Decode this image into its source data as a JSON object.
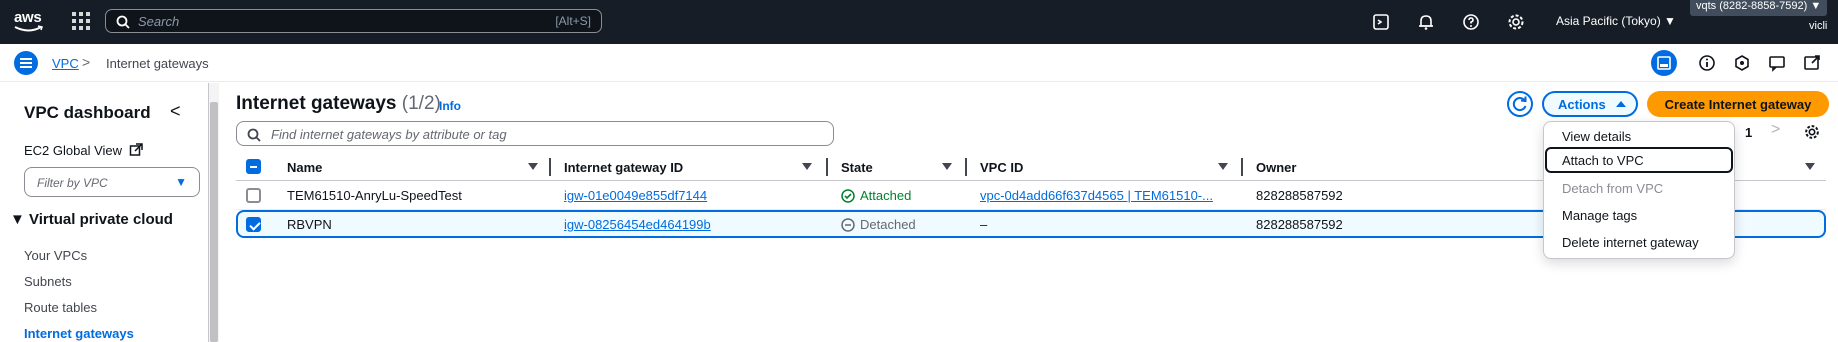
{
  "topbar": {
    "logo_text": "aws",
    "search_placeholder": "Search",
    "search_shortcut": "[Alt+S]",
    "icons": [
      "apps-grid-icon",
      "cloudshell-icon",
      "bell-icon",
      "help-icon",
      "gear-icon"
    ],
    "region": "Asia Pacific (Tokyo) ▼",
    "account": "vqts (8282-8858-7592) ▼",
    "user": "vicli"
  },
  "breadcrumb": {
    "root": "VPC",
    "separator": ">",
    "current": "Internet gateways"
  },
  "sidenav": {
    "title": "VPC dashboard",
    "collapse": "<",
    "ec2_global_view": "EC2 Global View",
    "filter_placeholder": "Filter by VPC",
    "section": "▼ Virtual private cloud",
    "items": [
      {
        "label": "Your VPCs",
        "active": false
      },
      {
        "label": "Subnets",
        "active": false
      },
      {
        "label": "Route tables",
        "active": false
      },
      {
        "label": "Internet gateways",
        "active": true
      }
    ]
  },
  "main": {
    "title": "Internet gateways",
    "count": "(1/2)",
    "info": "Info",
    "actions_label": "Actions",
    "create_label": "Create Internet gateway",
    "filter_placeholder": "Find internet gateways by attribute or tag",
    "page_number": "1",
    "columns": [
      "Name",
      "Internet gateway ID",
      "State",
      "VPC ID",
      "Owner"
    ],
    "rows": [
      {
        "name": "TEM61510-AnryLu-SpeedTest",
        "id": "igw-01e0049e855df7144",
        "state": "Attached",
        "vpc": "vpc-0d4add66f637d4565 | TEM61510-...",
        "owner": "828288587592",
        "selected": false
      },
      {
        "name": "RBVPN",
        "id": "igw-08256454ed464199b",
        "state": "Detached",
        "vpc": "–",
        "owner": "828288587592",
        "selected": true
      }
    ]
  },
  "actions_menu": {
    "items": [
      {
        "label": "View details",
        "disabled": false
      },
      {
        "label": "Attach to VPC",
        "disabled": false,
        "focused": true
      },
      {
        "label": "Detach from VPC",
        "disabled": true
      },
      {
        "label": "Manage tags",
        "disabled": false
      },
      {
        "label": "Delete internet gateway",
        "disabled": false
      }
    ]
  },
  "colors": {
    "nav_bg": "#161d26",
    "link": "#006ce0",
    "primary_button": "#ff9900",
    "attached": "#00802f",
    "selection_bg": "#f0fbff"
  }
}
